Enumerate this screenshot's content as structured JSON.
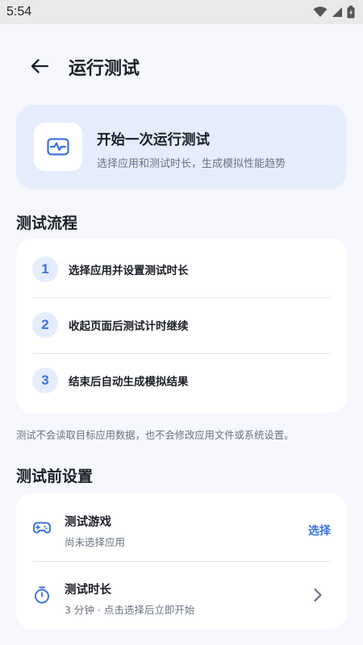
{
  "status_bar": {
    "time": "5:54",
    "icons": [
      "wifi-icon",
      "signal-icon",
      "battery-icon"
    ]
  },
  "app_bar": {
    "back_icon": "arrow-left-icon",
    "title": "运行测试"
  },
  "hero": {
    "icon": "activity-monitor-icon",
    "title": "开始一次运行测试",
    "subtitle": "选择应用和测试时长，生成模拟性能趋势"
  },
  "process": {
    "section_title": "测试流程",
    "steps": [
      {
        "number": "1",
        "label": "选择应用并设置测试时长"
      },
      {
        "number": "2",
        "label": "收起页面后测试计时继续"
      },
      {
        "number": "3",
        "label": "结束后自动生成模拟结果"
      }
    ]
  },
  "note": "测试不会读取目标应用数据，也不会修改应用文件或系统设置。",
  "settings": {
    "section_title": "测试前设置",
    "game": {
      "icon": "gamepad-icon",
      "title": "测试游戏",
      "subtitle": "尚未选择应用",
      "action": "选择"
    },
    "duration": {
      "icon": "timer-icon",
      "title": "测试时长",
      "subtitle": "3 分钟 · 点击选择后立即开始",
      "action_icon": "chevron-right-icon"
    }
  },
  "colors": {
    "accent": "#3b73e0",
    "hero_background": "#e5edfd",
    "page_background": "#f5f7fc",
    "card_background": "#ffffff"
  }
}
